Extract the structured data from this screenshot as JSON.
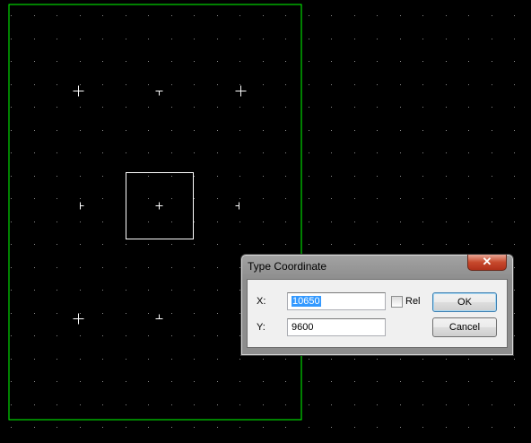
{
  "dialog": {
    "title": "Type Coordinate",
    "close_glyph": "✕",
    "x_label": "X:",
    "x_value": "10650",
    "y_label": "Y:",
    "y_value": "9600",
    "rel_label": "Rel",
    "rel_checked": false,
    "ok_label": "OK",
    "cancel_label": "Cancel"
  },
  "colors": {
    "background": "#000000",
    "grid_dot": "#8a8a8a",
    "board_outline": "#00ff00",
    "markers": "#ffffff"
  }
}
